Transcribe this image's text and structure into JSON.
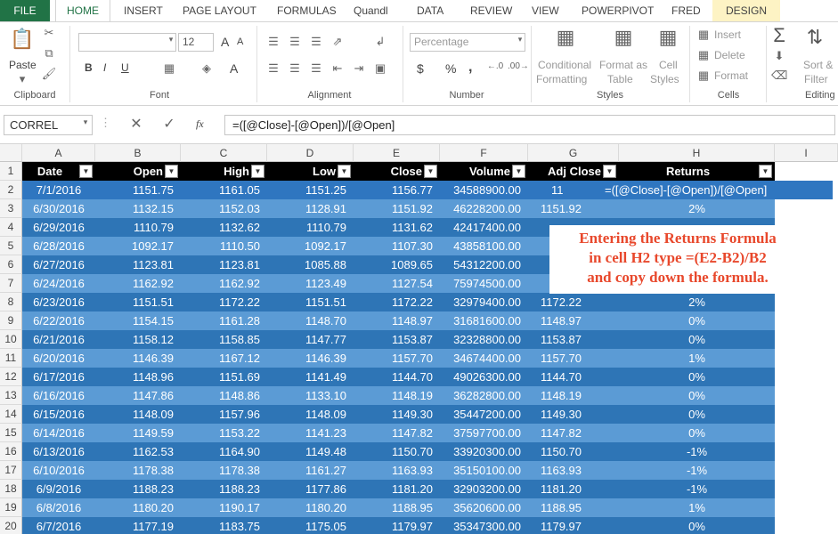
{
  "tabs": {
    "file": "FILE",
    "home": "HOME",
    "insert": "INSERT",
    "page_layout": "PAGE LAYOUT",
    "formulas": "FORMULAS",
    "quandl": "Quandl",
    "data": "DATA",
    "review": "REVIEW",
    "view": "VIEW",
    "powerpivot": "POWERPIVOT",
    "fred": "FRED",
    "design": "DESIGN"
  },
  "ribbon": {
    "clipboard": {
      "paste": "Paste",
      "label": "Clipboard"
    },
    "font": {
      "size": "12",
      "bold": "B",
      "italic": "I",
      "underline": "U",
      "grow": "A",
      "shrink": "A",
      "color": "A",
      "label": "Font"
    },
    "alignment": {
      "label": "Alignment"
    },
    "number": {
      "format": "Percentage",
      "currency": "$",
      "percent": "%",
      "comma": ",",
      "inc_dec": "←.0\n.00",
      "dec_dec": ".00\n→.0",
      "label": "Number"
    },
    "styles": {
      "conditional": "Conditional",
      "formatting": "Formatting",
      "format_as": "Format as",
      "table": "Table",
      "cell": "Cell",
      "styles_word": "Styles",
      "label": "Styles"
    },
    "cells": {
      "insert": "Insert",
      "delete": "Delete",
      "format": "Format",
      "label": "Cells"
    },
    "editing": {
      "sort": "Sort &",
      "filter": "Filter",
      "label": "Editing"
    }
  },
  "formula_bar": {
    "name_box": "CORREL",
    "fx": "fx",
    "formula": "=([@Close]-[@Open])/[@Open]"
  },
  "columns": [
    "A",
    "B",
    "C",
    "D",
    "E",
    "F",
    "G",
    "H",
    "I"
  ],
  "headers": [
    "Date",
    "Open",
    "High",
    "Low",
    "Close",
    "Volume",
    "Adj Close",
    "Returns"
  ],
  "rows": [
    {
      "n": "2",
      "date": "7/1/2016",
      "open": "1151.75",
      "high": "1161.05",
      "low": "1151.25",
      "close": "1156.77",
      "volume": "34588900.00",
      "adj": "11",
      "ret": "=([@Close]-[@Open])/[@Open]"
    },
    {
      "n": "3",
      "date": "6/30/2016",
      "open": "1132.15",
      "high": "1152.03",
      "low": "1128.91",
      "close": "1151.92",
      "volume": "46228200.00",
      "adj": "1151.92",
      "ret": "2%"
    },
    {
      "n": "4",
      "date": "6/29/2016",
      "open": "1110.79",
      "high": "1132.62",
      "low": "1110.79",
      "close": "1131.62",
      "volume": "42417400.00",
      "adj": "",
      "ret": ""
    },
    {
      "n": "5",
      "date": "6/28/2016",
      "open": "1092.17",
      "high": "1110.50",
      "low": "1092.17",
      "close": "1107.30",
      "volume": "43858100.00",
      "adj": "",
      "ret": ""
    },
    {
      "n": "6",
      "date": "6/27/2016",
      "open": "1123.81",
      "high": "1123.81",
      "low": "1085.88",
      "close": "1089.65",
      "volume": "54312200.00",
      "adj": "",
      "ret": ""
    },
    {
      "n": "7",
      "date": "6/24/2016",
      "open": "1162.92",
      "high": "1162.92",
      "low": "1123.49",
      "close": "1127.54",
      "volume": "75974500.00",
      "adj": "",
      "ret": ""
    },
    {
      "n": "8",
      "date": "6/23/2016",
      "open": "1151.51",
      "high": "1172.22",
      "low": "1151.51",
      "close": "1172.22",
      "volume": "32979400.00",
      "adj": "1172.22",
      "ret": "2%"
    },
    {
      "n": "9",
      "date": "6/22/2016",
      "open": "1154.15",
      "high": "1161.28",
      "low": "1148.70",
      "close": "1148.97",
      "volume": "31681600.00",
      "adj": "1148.97",
      "ret": "0%"
    },
    {
      "n": "10",
      "date": "6/21/2016",
      "open": "1158.12",
      "high": "1158.85",
      "low": "1147.77",
      "close": "1153.87",
      "volume": "32328800.00",
      "adj": "1153.87",
      "ret": "0%"
    },
    {
      "n": "11",
      "date": "6/20/2016",
      "open": "1146.39",
      "high": "1167.12",
      "low": "1146.39",
      "close": "1157.70",
      "volume": "34674400.00",
      "adj": "1157.70",
      "ret": "1%"
    },
    {
      "n": "12",
      "date": "6/17/2016",
      "open": "1148.96",
      "high": "1151.69",
      "low": "1141.49",
      "close": "1144.70",
      "volume": "49026300.00",
      "adj": "1144.70",
      "ret": "0%"
    },
    {
      "n": "13",
      "date": "6/16/2016",
      "open": "1147.86",
      "high": "1148.86",
      "low": "1133.10",
      "close": "1148.19",
      "volume": "36282800.00",
      "adj": "1148.19",
      "ret": "0%"
    },
    {
      "n": "14",
      "date": "6/15/2016",
      "open": "1148.09",
      "high": "1157.96",
      "low": "1148.09",
      "close": "1149.30",
      "volume": "35447200.00",
      "adj": "1149.30",
      "ret": "0%"
    },
    {
      "n": "15",
      "date": "6/14/2016",
      "open": "1149.59",
      "high": "1153.22",
      "low": "1141.23",
      "close": "1147.82",
      "volume": "37597700.00",
      "adj": "1147.82",
      "ret": "0%"
    },
    {
      "n": "16",
      "date": "6/13/2016",
      "open": "1162.53",
      "high": "1164.90",
      "low": "1149.48",
      "close": "1150.70",
      "volume": "33920300.00",
      "adj": "1150.70",
      "ret": "-1%"
    },
    {
      "n": "17",
      "date": "6/10/2016",
      "open": "1178.38",
      "high": "1178.38",
      "low": "1161.27",
      "close": "1163.93",
      "volume": "35150100.00",
      "adj": "1163.93",
      "ret": "-1%"
    },
    {
      "n": "18",
      "date": "6/9/2016",
      "open": "1188.23",
      "high": "1188.23",
      "low": "1177.86",
      "close": "1181.20",
      "volume": "32903200.00",
      "adj": "1181.20",
      "ret": "-1%"
    },
    {
      "n": "19",
      "date": "6/8/2016",
      "open": "1180.20",
      "high": "1190.17",
      "low": "1180.20",
      "close": "1188.95",
      "volume": "35620600.00",
      "adj": "1188.95",
      "ret": "1%"
    },
    {
      "n": "20",
      "date": "6/7/2016",
      "open": "1177.19",
      "high": "1183.75",
      "low": "1175.05",
      "close": "1179.97",
      "volume": "35347300.00",
      "adj": "1179.97",
      "ret": "0%"
    }
  ],
  "callout": {
    "line1": "Entering the Returns Formula",
    "line2": "in cell H2 type =(E2-B2)/B2",
    "line3": "and copy down the formula."
  },
  "colors": {
    "dark_band": "#2e75b6",
    "light_band": "#5b9bd5",
    "selected_row": "#2f76c0",
    "header": "#000000",
    "file_tab": "#217346",
    "callout_text": "#e8482c"
  }
}
